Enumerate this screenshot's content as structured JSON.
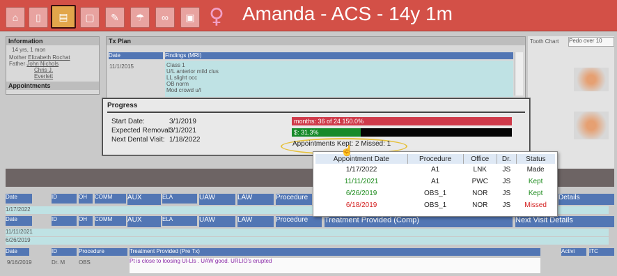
{
  "toolbar": {
    "buttons": [
      {
        "icon": "home-icon",
        "glyph": "⌂"
      },
      {
        "icon": "document-icon",
        "glyph": "▯"
      },
      {
        "icon": "ortho-chart-icon",
        "glyph": "▤",
        "active": true
      },
      {
        "icon": "form-icon",
        "glyph": "▢"
      },
      {
        "icon": "tools-icon",
        "glyph": "✎"
      },
      {
        "icon": "umbrella-icon",
        "glyph": "☂"
      },
      {
        "icon": "link-icon",
        "glyph": "∞"
      },
      {
        "icon": "money-icon",
        "glyph": "▣"
      }
    ]
  },
  "patient": {
    "gender_symbol": "♀",
    "title": "Amanda - ACS - 14y 1m"
  },
  "info_panel": {
    "header": "Information",
    "age": "14 yrs, 1 mon",
    "mother_label": "Mother",
    "mother": "Elizabeth Rochat",
    "father_label": "Father",
    "father": "John Nichols",
    "other": "Chris J. Everlett",
    "appointments_header": "Appointments"
  },
  "tx_plan": {
    "header": "Tx Plan",
    "col_date": "Date",
    "col_findings": "Findings (MRI)",
    "row_date": "11/1/2015",
    "findings_lines": [
      "Class 1",
      "U/L anterior mild clus",
      "LL slight occ",
      "OB norm",
      "Mod crowd u/l"
    ]
  },
  "tooth_chart": {
    "label": "Tooth Chart",
    "select_value": "Pedo over 10"
  },
  "progress": {
    "title": "Progress",
    "start_label": "Start Date:",
    "start_value": "3/1/2019",
    "removal_label": "Expected Removal:",
    "removal_value": "3/1/2021",
    "next_label": "Next Dental Visit:",
    "next_value": "1/18/2022",
    "months_bar_text": "months: 36 of 24 150.0%",
    "dollars_bar_text": "$:  31.3%",
    "dollars_fraction": 0.313,
    "appointments_summary": "Appointments Kept: 2 Missed: 1"
  },
  "appointments_popup": {
    "columns": [
      "Appointment Date",
      "Procedure",
      "Office",
      "Dr.",
      "Status"
    ],
    "rows": [
      {
        "date": "1/17/2022",
        "procedure": "A1",
        "office": "LNK",
        "dr": "JS",
        "status": "Made",
        "tone": "black"
      },
      {
        "date": "11/11/2021",
        "procedure": "A1",
        "office": "PWC",
        "dr": "JS",
        "status": "Kept",
        "tone": "green"
      },
      {
        "date": "6/26/2019",
        "procedure": "OBS_1",
        "office": "NOR",
        "dr": "JS",
        "status": "Kept",
        "tone": "green"
      },
      {
        "date": "6/18/2019",
        "procedure": "OBS_1",
        "office": "NOR",
        "dr": "JS",
        "status": "Missed",
        "tone": "red"
      }
    ]
  },
  "grid": {
    "row1_headers": [
      "Date",
      "ID",
      "OH",
      "COMM",
      "AUX",
      "ELA",
      "UAW",
      "LAW",
      "Procedure",
      "Details"
    ],
    "row1_date": "1/17/2022",
    "row2_headers": [
      "Date",
      "ID",
      "OH",
      "COMM",
      "AUX",
      "ELA",
      "UAW",
      "LAW",
      "Procedure",
      "Treatment Provided (Comp)",
      "Next Visit Details"
    ],
    "row2_dates": [
      "11/11/2021",
      "6/26/2019"
    ],
    "row3_headers": [
      "Date",
      "ID",
      "Procedure",
      "Treatment Provided (Pre Tx)",
      "Activi",
      "ITC"
    ],
    "row3_date": "9/16/2019",
    "row3_id": "Dr. M",
    "row3_proc": "OBS",
    "row3_note": "Pt is close to loosing Ul-Lls . UAW good. URLIO's erupted"
  },
  "colors": {
    "topbar": "#d35047",
    "kept": "#1b8a1b",
    "missed": "#e01b1b",
    "months_bar": "#cf3a4a",
    "dollars_fill": "#168a2a"
  }
}
